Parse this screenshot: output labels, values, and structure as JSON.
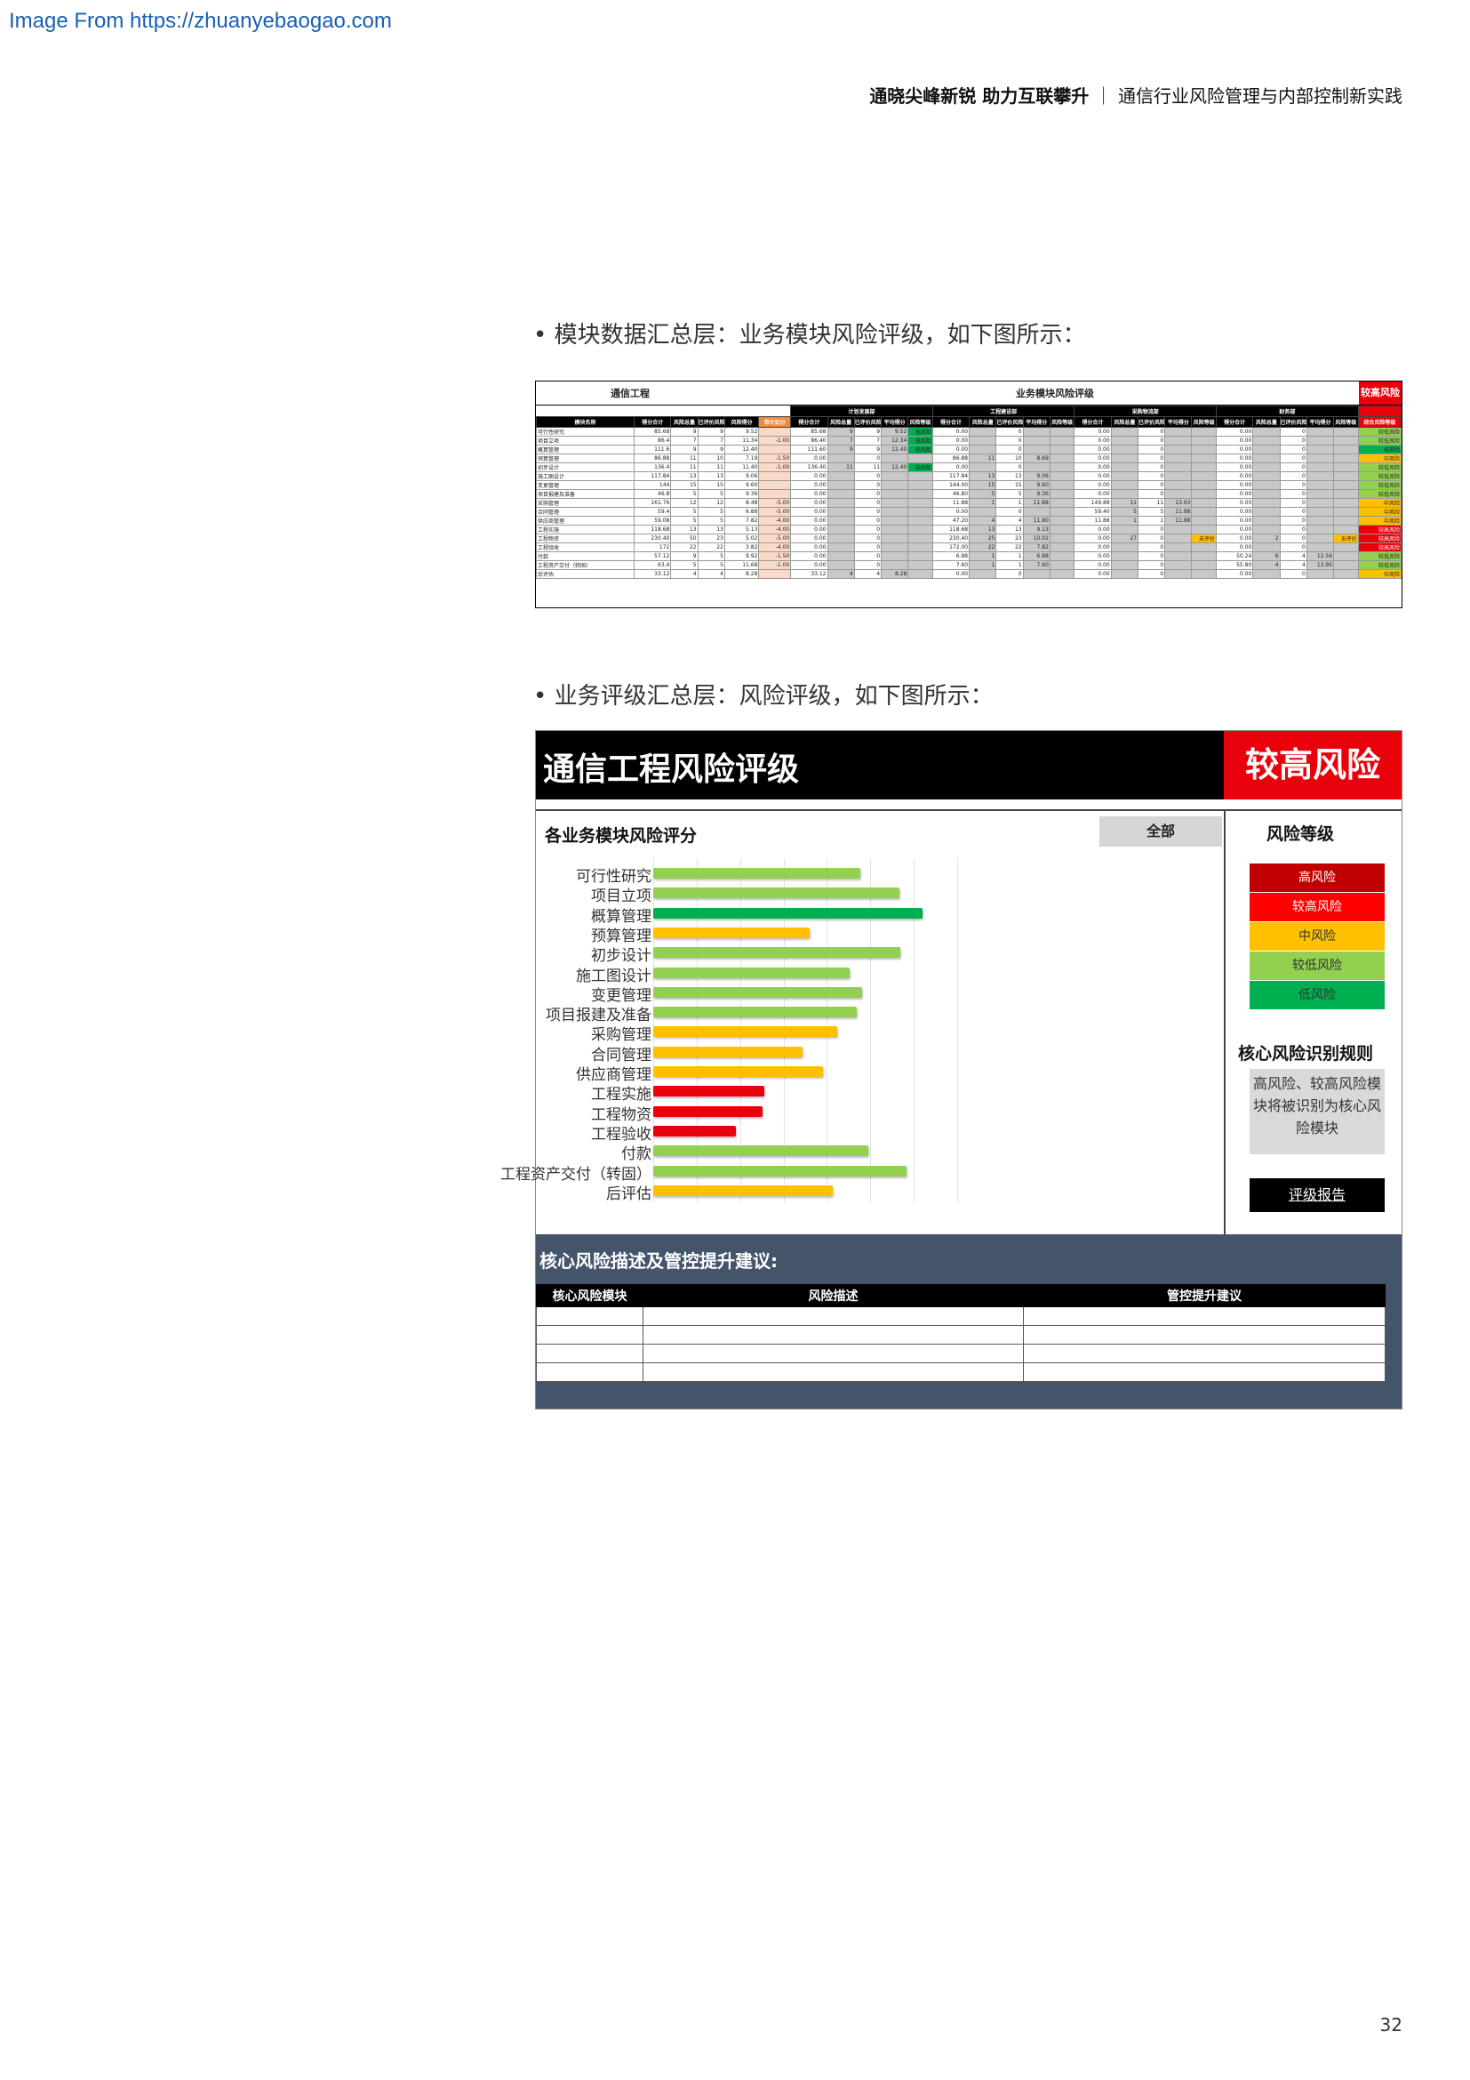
{
  "watermark": "Image From https://zhuanyebaogao.com",
  "running_head": {
    "bold": "通晓尖峰新锐 助力互联攀升",
    "sep": "｜",
    "rest": "通信行业风险管理与内部控制新实践"
  },
  "bullet1": "• 模块数据汇总层：业务模块风险评级，如下图所示：",
  "bullet2": "• 业务评级汇总层：风险评级，如下图所示：",
  "page_number": "32",
  "table_figure": {
    "left_title": "通信工程",
    "mid_title": "业务模块风险评级",
    "right_badge": "较高风险",
    "group_headers": [
      "计划发展部",
      "工程建设部",
      "采购物流部",
      "财务部"
    ],
    "col_headers": [
      "模块名称",
      "得分合计",
      "风险总量",
      "已评价风险数量",
      "风险得分",
      "审计扣分",
      "得分合计",
      "风险总量",
      "已评价风险数量",
      "平均得分",
      "风险等级",
      "得分合计",
      "风险总量",
      "已评价风险数量",
      "平均得分",
      "风险等级",
      "得分合计",
      "风险总量",
      "已评价风险数量",
      "平均得分",
      "风险等级",
      "得分合计",
      "风险总量",
      "已评价风险数量",
      "平均得分",
      "风险等级",
      "综合风险等级"
    ],
    "rows": [
      {
        "name": "可行性研究",
        "v": [
          "85.68",
          "9",
          "9",
          "9.52",
          "",
          "85.68",
          "9",
          "9",
          "9.52",
          "低风险",
          "0.00",
          "",
          "0",
          "",
          "",
          "0.00",
          "",
          "0",
          "",
          "",
          "0.00",
          "",
          "0",
          "",
          "",
          "较低风险"
        ]
      },
      {
        "name": "项目立项",
        "v": [
          "86.4",
          "7",
          "7",
          "11.34",
          "-1.00",
          "86.40",
          "7",
          "7",
          "12.34",
          "低风险",
          "0.00",
          "",
          "0",
          "",
          "",
          "0.00",
          "",
          "0",
          "",
          "",
          "0.00",
          "",
          "0",
          "",
          "",
          "较低风险"
        ]
      },
      {
        "name": "概算管理",
        "v": [
          "111.6",
          "9",
          "9",
          "12.40",
          "",
          "111.60",
          "9",
          "9",
          "12.40",
          "低风险",
          "0.00",
          "",
          "0",
          "",
          "",
          "0.00",
          "",
          "0",
          "",
          "",
          "0.00",
          "",
          "0",
          "",
          "",
          "低风险"
        ]
      },
      {
        "name": "预算管理",
        "v": [
          "86.88",
          "11",
          "10",
          "7.19",
          "-1.50",
          "0.00",
          "",
          "0",
          "",
          "",
          "86.88",
          "11",
          "10",
          "8.69",
          "",
          "0.00",
          "",
          "0",
          "",
          "",
          "0.00",
          "",
          "0",
          "",
          "",
          "中风险"
        ]
      },
      {
        "name": "初步设计",
        "v": [
          "136.4",
          "11",
          "11",
          "11.40",
          "-1.00",
          "136.40",
          "11",
          "11",
          "12.40",
          "低风险",
          "0.00",
          "",
          "0",
          "",
          "",
          "0.00",
          "",
          "0",
          "",
          "",
          "0.00",
          "",
          "0",
          "",
          "",
          "较低风险"
        ]
      },
      {
        "name": "施工图设计",
        "v": [
          "117.84",
          "13",
          "13",
          "9.06",
          "",
          "0.00",
          "",
          "0",
          "",
          "",
          "117.84",
          "13",
          "13",
          "9.06",
          "",
          "0.00",
          "",
          "0",
          "",
          "",
          "0.00",
          "",
          "0",
          "",
          "",
          "较低风险"
        ]
      },
      {
        "name": "变更管理",
        "v": [
          "144",
          "15",
          "15",
          "9.60",
          "",
          "0.00",
          "",
          "0",
          "",
          "",
          "144.00",
          "15",
          "15",
          "9.60",
          "",
          "0.00",
          "",
          "0",
          "",
          "",
          "0.00",
          "",
          "0",
          "",
          "",
          "较低风险"
        ]
      },
      {
        "name": "项目报建及准备",
        "v": [
          "46.8",
          "5",
          "5",
          "9.36",
          "",
          "0.00",
          "",
          "0",
          "",
          "",
          "46.80",
          "5",
          "5",
          "9.36",
          "",
          "0.00",
          "",
          "0",
          "",
          "",
          "0.00",
          "",
          "0",
          "",
          "",
          "较低风险"
        ]
      },
      {
        "name": "采购管理",
        "v": [
          "161.76",
          "12",
          "12",
          "8.48",
          "-5.00",
          "0.00",
          "",
          "0",
          "",
          "",
          "11.88",
          "1",
          "1",
          "11.88",
          "",
          "149.88",
          "11",
          "11",
          "13.63",
          "",
          "0.00",
          "",
          "0",
          "",
          "",
          "中风险"
        ]
      },
      {
        "name": "合同管理",
        "v": [
          "59.4",
          "5",
          "5",
          "6.88",
          "-5.00",
          "0.00",
          "",
          "0",
          "",
          "",
          "0.00",
          "",
          "0",
          "",
          "",
          "59.40",
          "5",
          "5",
          "11.88",
          "",
          "0.00",
          "",
          "0",
          "",
          "",
          "中风险"
        ]
      },
      {
        "name": "供应商管理",
        "v": [
          "59.08",
          "5",
          "5",
          "7.82",
          "-4.00",
          "0.00",
          "",
          "0",
          "",
          "",
          "47.20",
          "4",
          "4",
          "11.80",
          "",
          "11.88",
          "1",
          "1",
          "11.88",
          "",
          "0.00",
          "",
          "0",
          "",
          "",
          "中风险"
        ]
      },
      {
        "name": "工程实施",
        "v": [
          "118.68",
          "13",
          "13",
          "5.13",
          "-4.00",
          "0.00",
          "",
          "0",
          "",
          "",
          "118.68",
          "13",
          "13",
          "9.13",
          "",
          "0.00",
          "",
          "0",
          "",
          "",
          "0.00",
          "",
          "0",
          "",
          "",
          "较高风险"
        ]
      },
      {
        "name": "工程物资",
        "v": [
          "230.40",
          "50",
          "23",
          "5.02",
          "-5.00",
          "0.00",
          "",
          "0",
          "",
          "",
          "230.40",
          "25",
          "23",
          "10.02",
          "",
          "0.00",
          "27",
          "0",
          "",
          "未评价",
          "0.00",
          "2",
          "0",
          "",
          "未评价",
          "较高风险"
        ]
      },
      {
        "name": "工程验收",
        "v": [
          "172",
          "22",
          "22",
          "3.82",
          "-4.00",
          "0.00",
          "",
          "0",
          "",
          "",
          "172.00",
          "22",
          "22",
          "7.82",
          "",
          "0.00",
          "",
          "0",
          "",
          "",
          "0.00",
          "",
          "0",
          "",
          "",
          "较高风险"
        ]
      },
      {
        "name": "付款",
        "v": [
          "57.12",
          "9",
          "5",
          "9.92",
          "-1.50",
          "0.00",
          "",
          "0",
          "",
          "",
          "6.88",
          "1",
          "1",
          "6.88",
          "",
          "0.00",
          "",
          "0",
          "",
          "",
          "50.24",
          "6",
          "4",
          "12.56",
          "",
          "较低风险"
        ]
      },
      {
        "name": "工程资产交付（转固）",
        "v": [
          "63.4",
          "5",
          "5",
          "11.68",
          "-1.00",
          "0.00",
          "",
          "0",
          "",
          "",
          "7.60",
          "1",
          "1",
          "7.60",
          "",
          "0.00",
          "",
          "0",
          "",
          "",
          "55.80",
          "4",
          "4",
          "13.95",
          "",
          "较低风险"
        ]
      },
      {
        "name": "后评估",
        "v": [
          "33.12",
          "4",
          "4",
          "8.28",
          "",
          "33.12",
          "4",
          "4",
          "8.28",
          "",
          "0.00",
          "",
          "0",
          "",
          "",
          "0.00",
          "",
          "0",
          "",
          "",
          "0.00",
          "",
          "0",
          "",
          "",
          "中风险"
        ]
      }
    ]
  },
  "dashboard": {
    "title": "通信工程风险评级",
    "level": "较高风险",
    "chart_title": "各业务模块风险评分",
    "filter": "全部",
    "legend_title": "风险等级",
    "legend": [
      {
        "label": "高风险",
        "color": "#c00000",
        "text": "#ffffff"
      },
      {
        "label": "较高风险",
        "color": "#ff0000",
        "text": "#ffffff"
      },
      {
        "label": "中风险",
        "color": "#ffc000",
        "text": "#333333"
      },
      {
        "label": "较低风险",
        "color": "#92d050",
        "text": "#333333"
      },
      {
        "label": "低风险",
        "color": "#00b050",
        "text": "#333333"
      }
    ],
    "rules_title": "核心风险识别规则",
    "rules_text": "高风险、较高风险模块将被识别为核心风险模块",
    "report_button": "评级报告",
    "bottom_title": "核心风险描述及管控提升建议:",
    "core_table_headers": [
      "核心风险模块",
      "风险描述",
      "管控提升建议"
    ]
  },
  "chart_data": {
    "type": "bar",
    "orientation": "horizontal",
    "title": "各业务模块风险评分",
    "categories": [
      "可行性研究",
      "项目立项",
      "概算管理",
      "预算管理",
      "初步设计",
      "施工图设计",
      "变更管理",
      "项目报建及准备",
      "采购管理",
      "合同管理",
      "供应商管理",
      "工程实施",
      "工程物资",
      "工程验收",
      "付款",
      "工程资产交付（转固）",
      "后评估"
    ],
    "values": [
      9.52,
      11.34,
      12.4,
      7.19,
      11.4,
      9.06,
      9.6,
      9.36,
      8.48,
      6.88,
      7.82,
      5.13,
      5.02,
      3.82,
      9.92,
      11.68,
      8.28
    ],
    "levels": [
      "较低风险",
      "较低风险",
      "低风险",
      "中风险",
      "较低风险",
      "较低风险",
      "较低风险",
      "较低风险",
      "中风险",
      "中风险",
      "中风险",
      "较高风险",
      "较高风险",
      "较高风险",
      "较低风险",
      "较低风险",
      "中风险"
    ],
    "level_colors": {
      "高风险": "#c00000",
      "较高风险": "#e8000b",
      "中风险": "#ffc000",
      "较低风险": "#92d050",
      "低风险": "#00b050"
    },
    "xlim": [
      0,
      14
    ],
    "grid": true,
    "legend": "right"
  }
}
